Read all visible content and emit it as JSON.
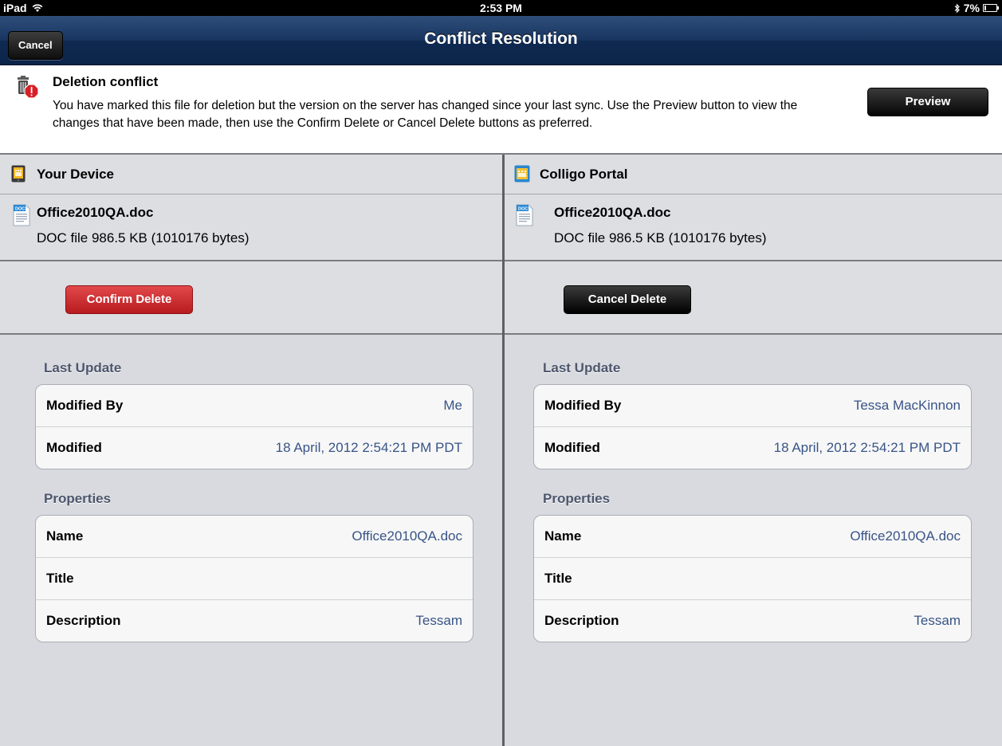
{
  "status_bar": {
    "device": "iPad",
    "time": "2:53 PM",
    "battery": "7%"
  },
  "nav": {
    "title": "Conflict Resolution",
    "cancel_label": "Cancel"
  },
  "banner": {
    "heading": "Deletion conflict",
    "message": "You have marked this file for deletion but the version on the server has changed since your last sync. Use the Preview button to view the changes that have been made, then use the Confirm Delete or Cancel Delete buttons as preferred.",
    "preview_label": "Preview"
  },
  "left": {
    "source": "Your Device",
    "file_name": "Office2010QA.doc",
    "file_meta": "DOC file  986.5 KB (1010176 bytes)",
    "action_label": "Confirm Delete",
    "last_update_title": "Last Update",
    "last_update": [
      {
        "key": "Modified By",
        "value": "Me"
      },
      {
        "key": "Modified",
        "value": "18 April, 2012 2:54:21 PM PDT"
      }
    ],
    "properties_title": "Properties",
    "properties": [
      {
        "key": "Name",
        "value": "Office2010QA.doc"
      },
      {
        "key": "Title",
        "value": ""
      },
      {
        "key": "Description",
        "value": "Tessam"
      }
    ]
  },
  "right": {
    "source": "Colligo Portal",
    "file_name": "Office2010QA.doc",
    "file_meta": "DOC file  986.5 KB (1010176 bytes)",
    "action_label": "Cancel Delete",
    "last_update_title": "Last Update",
    "last_update": [
      {
        "key": "Modified By",
        "value": "Tessa MacKinnon"
      },
      {
        "key": "Modified",
        "value": "18 April, 2012 2:54:21 PM PDT"
      }
    ],
    "properties_title": "Properties",
    "properties": [
      {
        "key": "Name",
        "value": "Office2010QA.doc"
      },
      {
        "key": "Title",
        "value": ""
      },
      {
        "key": "Description",
        "value": "Tessam"
      }
    ]
  },
  "colors": {
    "nav_bar": "#183560",
    "confirm_delete": "#c8262a",
    "value_text": "#385487",
    "section_title": "#4c566c"
  }
}
